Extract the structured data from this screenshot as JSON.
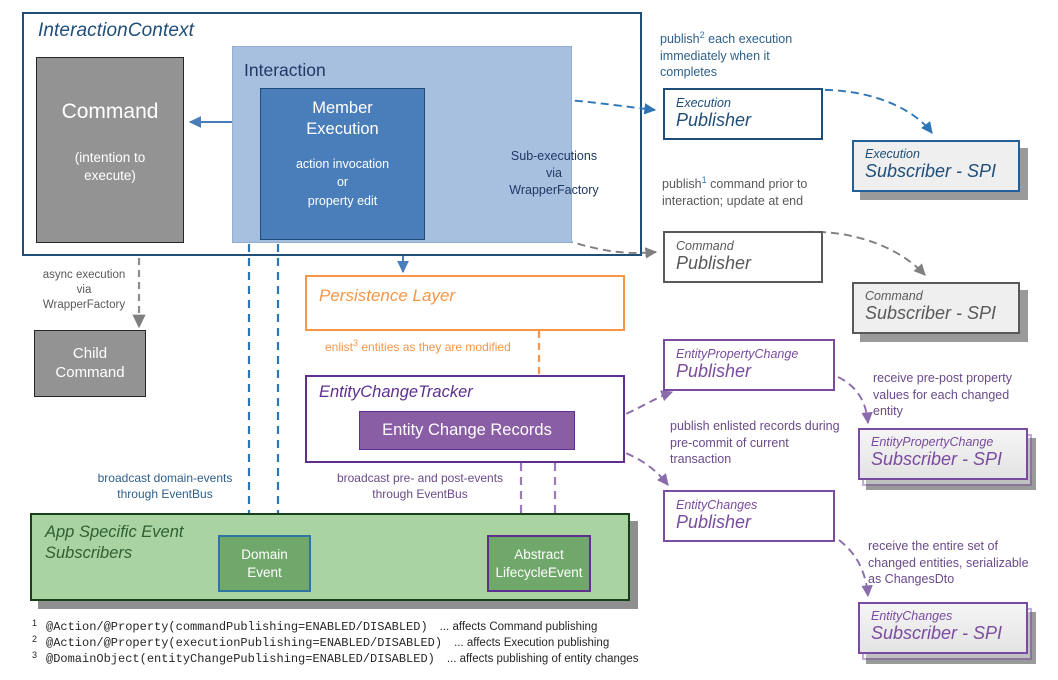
{
  "diagram": {
    "interaction_context": {
      "label": "InteractionContext",
      "command": {
        "title": "Command",
        "subtitle": "(intention to\nexecute)"
      },
      "interaction": {
        "label": "Interaction",
        "member_execution": {
          "title": "Member\nExecution",
          "subtitle": "action invocation\nor\nproperty  edit"
        },
        "sub_executions_label": "Sub-executions\nvia\nWrapperFactory"
      }
    },
    "async_note": "async execution\nvia\nWrapperFactory",
    "child_command": "Child\nCommand",
    "persistence_layer": {
      "label": "Persistence Layer"
    },
    "enlist_note": {
      "pre": "enlist",
      "sup": "3",
      "post": " entities as they are modified"
    },
    "entity_change_tracker": {
      "label": "EntityChangeTracker",
      "entity_change_records": "Entity Change Records"
    },
    "broadcast_domain_events": "broadcast domain-events\nthrough EventBus",
    "broadcast_pre_post_events": "broadcast pre- and post-events\nthrough EventBus",
    "app_subscribers": {
      "label": "App Specific Event\nSubscribers",
      "domain_event": "Domain\nEvent",
      "abstract_lifecycle_event": "Abstract\nLifecycleEvent"
    },
    "notes": {
      "execution_publish": {
        "pre": "publish",
        "sup": "2",
        "post": " each execution immediately when it completes"
      },
      "command_publish": {
        "pre": "publish",
        "sup": "1",
        "post": " command prior to interaction; update at end"
      },
      "pre_post_property": "receive pre-post property values for each changed entity",
      "enlisted_records": "publish enlisted records during pre-commit of current transaction",
      "entire_set": "receive the entire set of changed entities, serializable as ChangesDto"
    },
    "publishers": [
      {
        "id": "execution",
        "line1": "Execution",
        "line2": "Publisher"
      },
      {
        "id": "command",
        "line1": "Command",
        "line2": "Publisher"
      },
      {
        "id": "epc",
        "line1": "EntityPropertyChange",
        "line2": "Publisher"
      },
      {
        "id": "ec",
        "line1": "EntityChanges",
        "line2": "Publisher"
      }
    ],
    "subscribers": [
      {
        "id": "execution",
        "line1": "Execution",
        "line2": "Subscriber - SPI"
      },
      {
        "id": "command",
        "line1": "Command",
        "line2": "Subscriber - SPI"
      },
      {
        "id": "epc",
        "line1": "EntityPropertyChange",
        "line2": "Subscriber - SPI"
      },
      {
        "id": "ec",
        "line1": "EntityChanges",
        "line2": "Subscriber - SPI"
      }
    ],
    "footnotes": [
      {
        "num": "1",
        "code": "@Action/@Property(commandPublishing=ENABLED/DISABLED)",
        "desc": "... affects Command publishing"
      },
      {
        "num": "2",
        "code": "@Action/@Property(executionPublishing=ENABLED/DISABLED)",
        "desc": "... affects Execution publishing"
      },
      {
        "num": "3",
        "code": "@DomainObject(entityChangePublishing=ENABLED/DISABLED)",
        "desc": "... affects publishing of entity changes"
      }
    ]
  },
  "colors": {
    "blue_dark": "#1f4e79",
    "blue_mid": "#4a7ebb",
    "blue_light": "#a7c0e0",
    "gray": "#939393",
    "orange": "#f79646",
    "purple": "#5f2f8f",
    "purple_light": "#8a5ea5",
    "green": "#a9d3a0",
    "green_dark": "#17401a"
  }
}
